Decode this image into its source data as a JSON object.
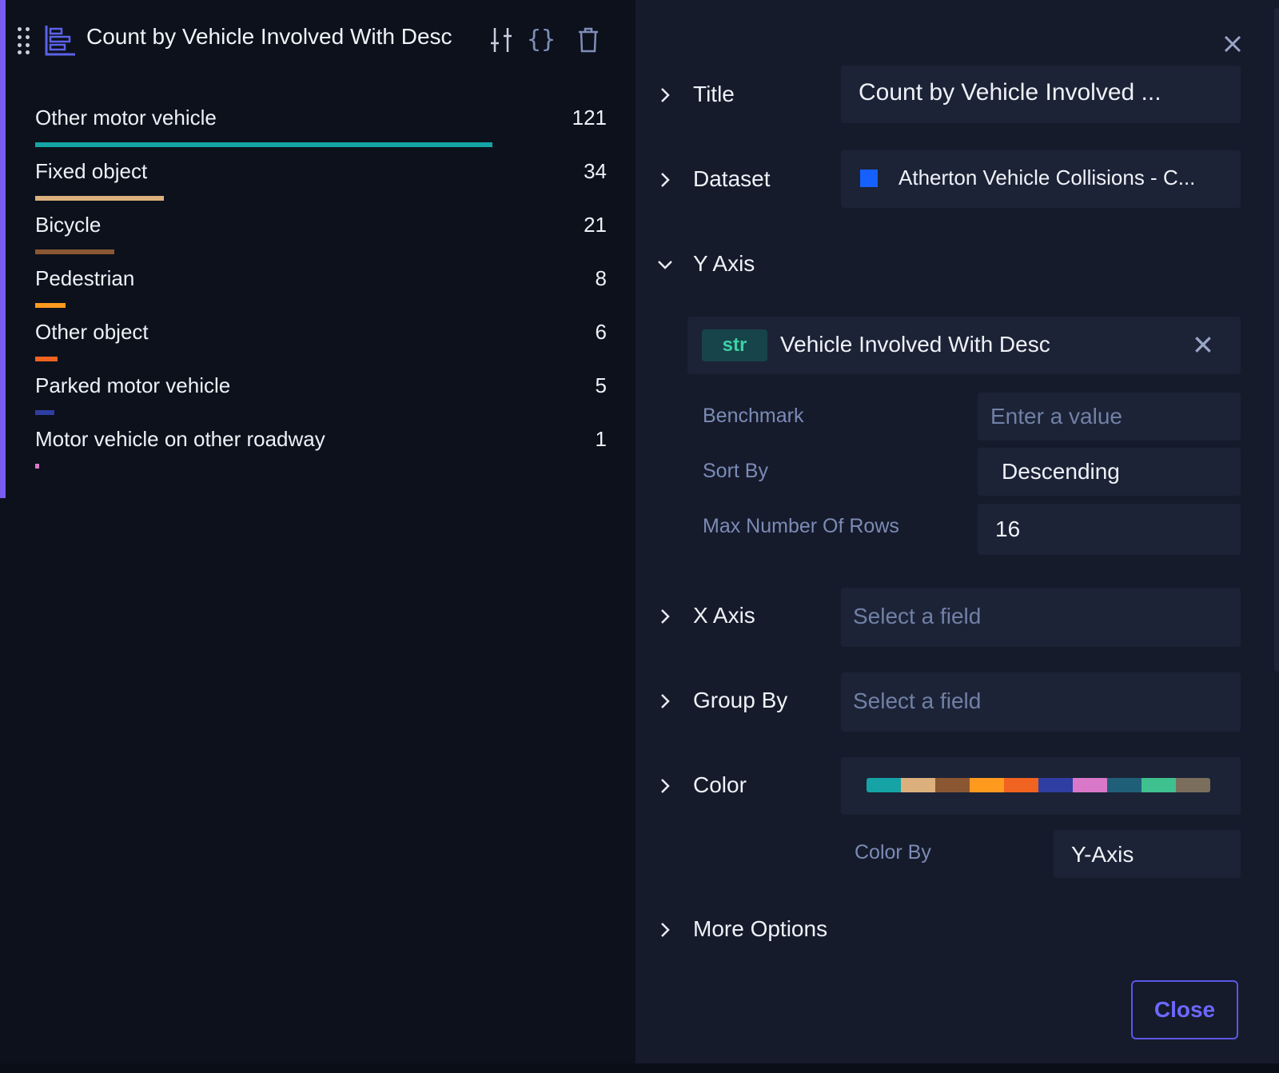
{
  "card": {
    "title": "Count by Vehicle Involved With Desc",
    "icons": [
      "drag-handle-icon",
      "bar-chart-icon",
      "sliders-icon",
      "braces-icon",
      "trash-icon"
    ]
  },
  "chart_data": {
    "type": "bar",
    "orientation": "horizontal",
    "categories": [
      "Other motor vehicle",
      "Fixed object",
      "Bicycle",
      "Pedestrian",
      "Other object",
      "Parked motor vehicle",
      "Motor vehicle on other roadway"
    ],
    "values": [
      121,
      34,
      21,
      8,
      6,
      5,
      1
    ],
    "value_labels": [
      "121",
      "34",
      "21",
      "8",
      "6",
      "5",
      "1"
    ],
    "colors": [
      "#15a3a6",
      "#dcb07c",
      "#8b5732",
      "#ff9a1f",
      "#f06321",
      "#2f3ea3",
      "#d978c8"
    ],
    "title": "",
    "xlabel": "",
    "ylabel": ""
  },
  "panel": {
    "title_section": {
      "label": "Title",
      "value": "Count by Vehicle Involved ..."
    },
    "dataset_section": {
      "label": "Dataset",
      "value": "Atherton Vehicle Collisions - C...",
      "color": "#1560ff"
    },
    "y_axis_section": {
      "label": "Y Axis",
      "field_type": "str",
      "field_name": "Vehicle Involved With Desc",
      "benchmark_label": "Benchmark",
      "benchmark_placeholder": "Enter a value",
      "sort_by_label": "Sort By",
      "sort_by_value": "Descending",
      "max_rows_label": "Max Number Of Rows",
      "max_rows_value": "16"
    },
    "x_axis_section": {
      "label": "X Axis",
      "placeholder": "Select a field"
    },
    "group_by_section": {
      "label": "Group By",
      "placeholder": "Select a field"
    },
    "color_section": {
      "label": "Color",
      "palette": [
        "#15a3a6",
        "#dcb07c",
        "#8b5732",
        "#ff9a1f",
        "#f06321",
        "#2f3ea3",
        "#d978c8",
        "#1f6078",
        "#3fc08f",
        "#7b6e5c"
      ],
      "color_by_label": "Color By",
      "color_by_value": "Y-Axis"
    },
    "more_options_label": "More Options",
    "close_label": "Close"
  }
}
